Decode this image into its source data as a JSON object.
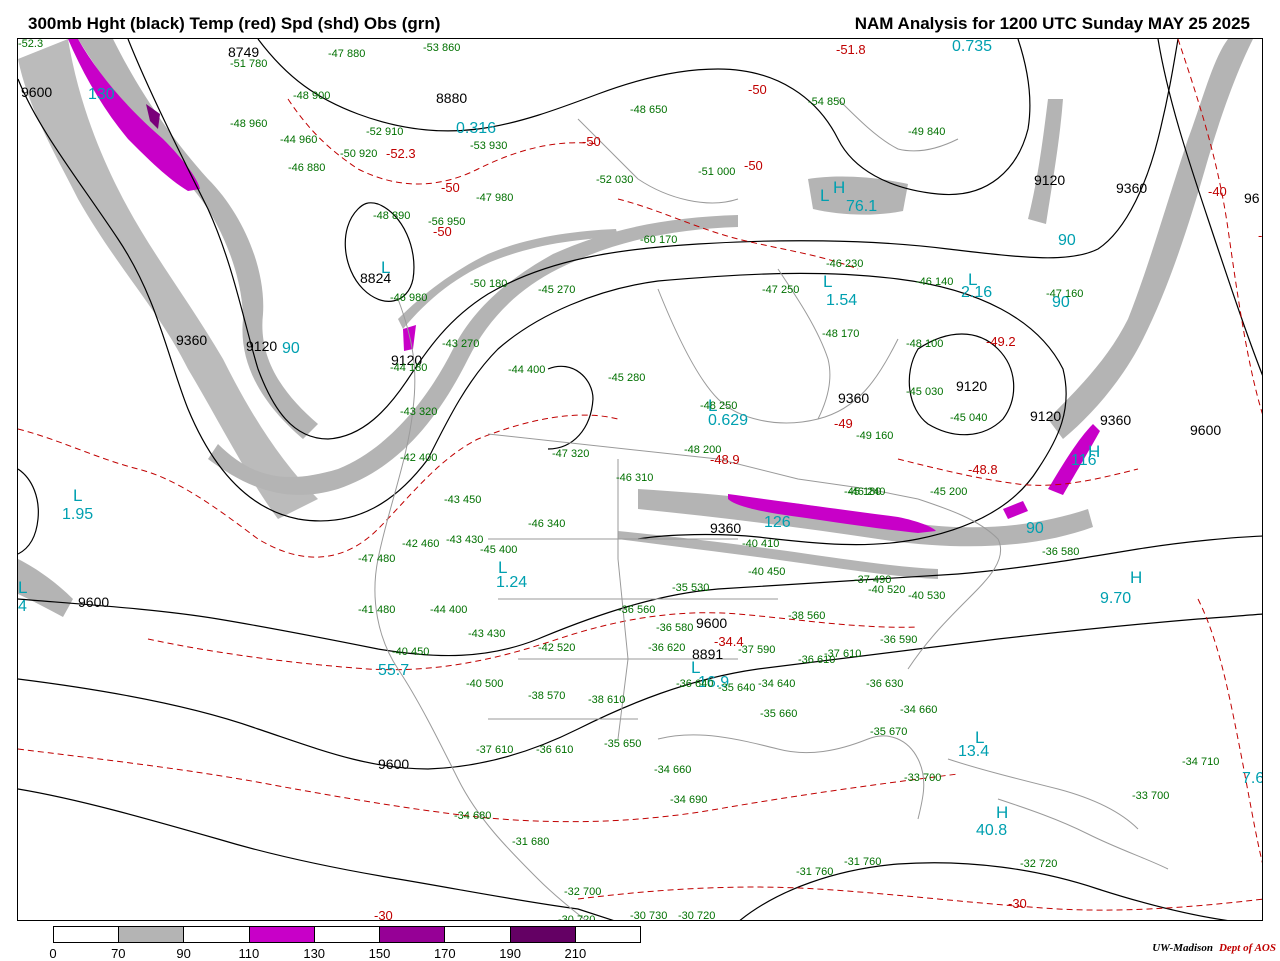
{
  "header": {
    "left_title": "300mb Hght (black) Temp (red) Spd (shd) Obs (grn)",
    "right_title": "NAM Analysis for 1200 UTC Sunday  MAY 25 2025"
  },
  "height_labels": [
    "9600",
    "8880",
    "9120",
    "9360",
    "96",
    "8824",
    "9360",
    "9120",
    "9120",
    "9360",
    "9120",
    "9360",
    "9600",
    "9360",
    "9600",
    "9600",
    "9600",
    "8891",
    "9120",
    "8749"
  ],
  "temp_labels": [
    "-52.3",
    "-51.8",
    "-50",
    "-50",
    "-50",
    "-50",
    "-40",
    "-50",
    "-49.2",
    "-49",
    "-48.8",
    "-48.9",
    "-40",
    "-34.4",
    "-30",
    "-30"
  ],
  "speed_labels": [
    "0.316",
    "0.735",
    "76.1",
    "90",
    "90",
    "2.16",
    "1.54",
    "90",
    "0.629",
    "126",
    "116",
    "90",
    "1.95",
    "1.24",
    "9.70",
    "55.7",
    "13.4",
    "40.8",
    "7.6",
    "130",
    "4",
    "16.9"
  ],
  "high_low_markers": [
    "H",
    "L",
    "L",
    "L",
    "L",
    "L",
    "H",
    "L",
    "H",
    "L",
    "H",
    "L",
    "L",
    "L"
  ],
  "observations": [
    "-47 880",
    "-53 860",
    "-51 780",
    "-48 900",
    "-48 960",
    "-44 960",
    "-52 910",
    "-52.3",
    "-53 930",
    "-50 920",
    "-46 880",
    "-48 650",
    "-54 850",
    "-49 840",
    "-52 030",
    "-47 980",
    "-51 000",
    "-48 890",
    "-56 950",
    "-60 170",
    "-46 230",
    "-46 140",
    "-47 250",
    "-47 160",
    "-45 270",
    "-48 170",
    "-46 980",
    "-50 180",
    "-48 100",
    "-43 270",
    "-44 180",
    "-44 400",
    "-43 320",
    "-45 280",
    "-48 250",
    "-45 030",
    "-45 040",
    "-48 200",
    "-49 160",
    "-42 400",
    "-47 320",
    "-46 310",
    "-43 450",
    "-46 340",
    "-45 180",
    "-46 240",
    "-45 200",
    "-42 460",
    "-43 430",
    "-45 400",
    "-47 480",
    "-40 410",
    "-36 580",
    "-41 480",
    "-44 400",
    "-40 450",
    "-37 490",
    "-40 520",
    "-40 530",
    "-35 530",
    "-36 560",
    "-38 560",
    "-43 430",
    "-42 520",
    "-36 580",
    "-36 620",
    "-37 590",
    "-36 610",
    "-37 610",
    "-36 590",
    "-40 450",
    "-40 500",
    "-38 570",
    "-38 610",
    "-35 640",
    "-34 640",
    "-36 640",
    "-36 630",
    "-35 660",
    "-34 660",
    "-35 670",
    "-37 610",
    "-36 610",
    "-35 650",
    "-34 660",
    "-34 690",
    "-33 700",
    "-34 710",
    "-33 700",
    "-34 680",
    "-31 680",
    "-31 760",
    "-31 760",
    "-32 720",
    "-32 700",
    "-30 720",
    "-30 730",
    "-30 720"
  ],
  "legend": {
    "colors": [
      "#ffffff",
      "#b4b4b4",
      "#ffffff",
      "#c800c8",
      "#ffffff",
      "#960096",
      "#ffffff",
      "#640064",
      "#ffffff"
    ],
    "labels": [
      "0",
      "70",
      "90",
      "110",
      "130",
      "150",
      "170",
      "190",
      "210"
    ]
  },
  "credit": {
    "org": "UW-Madison",
    "dept": "Dept of AOS"
  }
}
